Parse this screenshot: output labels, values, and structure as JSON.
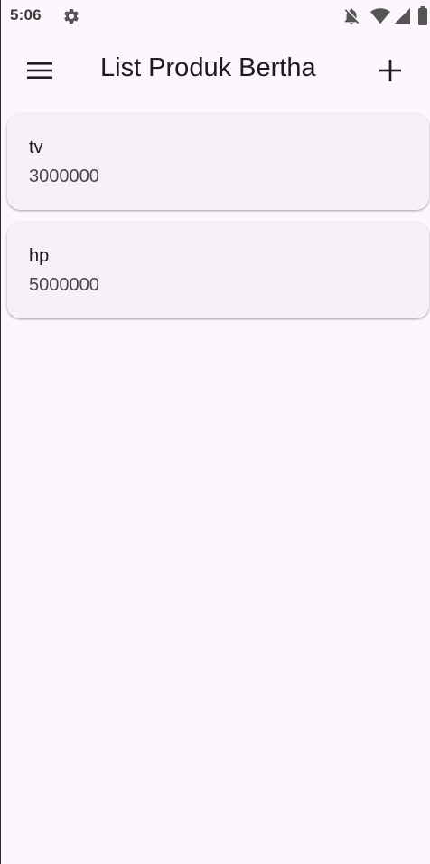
{
  "status_bar": {
    "time": "5:06",
    "icons": [
      "gear-icon",
      "notifications-off-icon",
      "wifi-icon",
      "cell-signal-icon",
      "battery-icon"
    ]
  },
  "app_bar": {
    "title": "List Produk Bertha",
    "menu_icon": "hamburger-menu-icon",
    "add_icon": "plus-icon"
  },
  "products": [
    {
      "name": "tv",
      "price": "3000000"
    },
    {
      "name": "hp",
      "price": "5000000"
    }
  ],
  "colors": {
    "background": "#fdf7fd",
    "card": "#f6f1f6",
    "text_primary": "#1d1b20",
    "text_secondary": "#4a4650"
  }
}
